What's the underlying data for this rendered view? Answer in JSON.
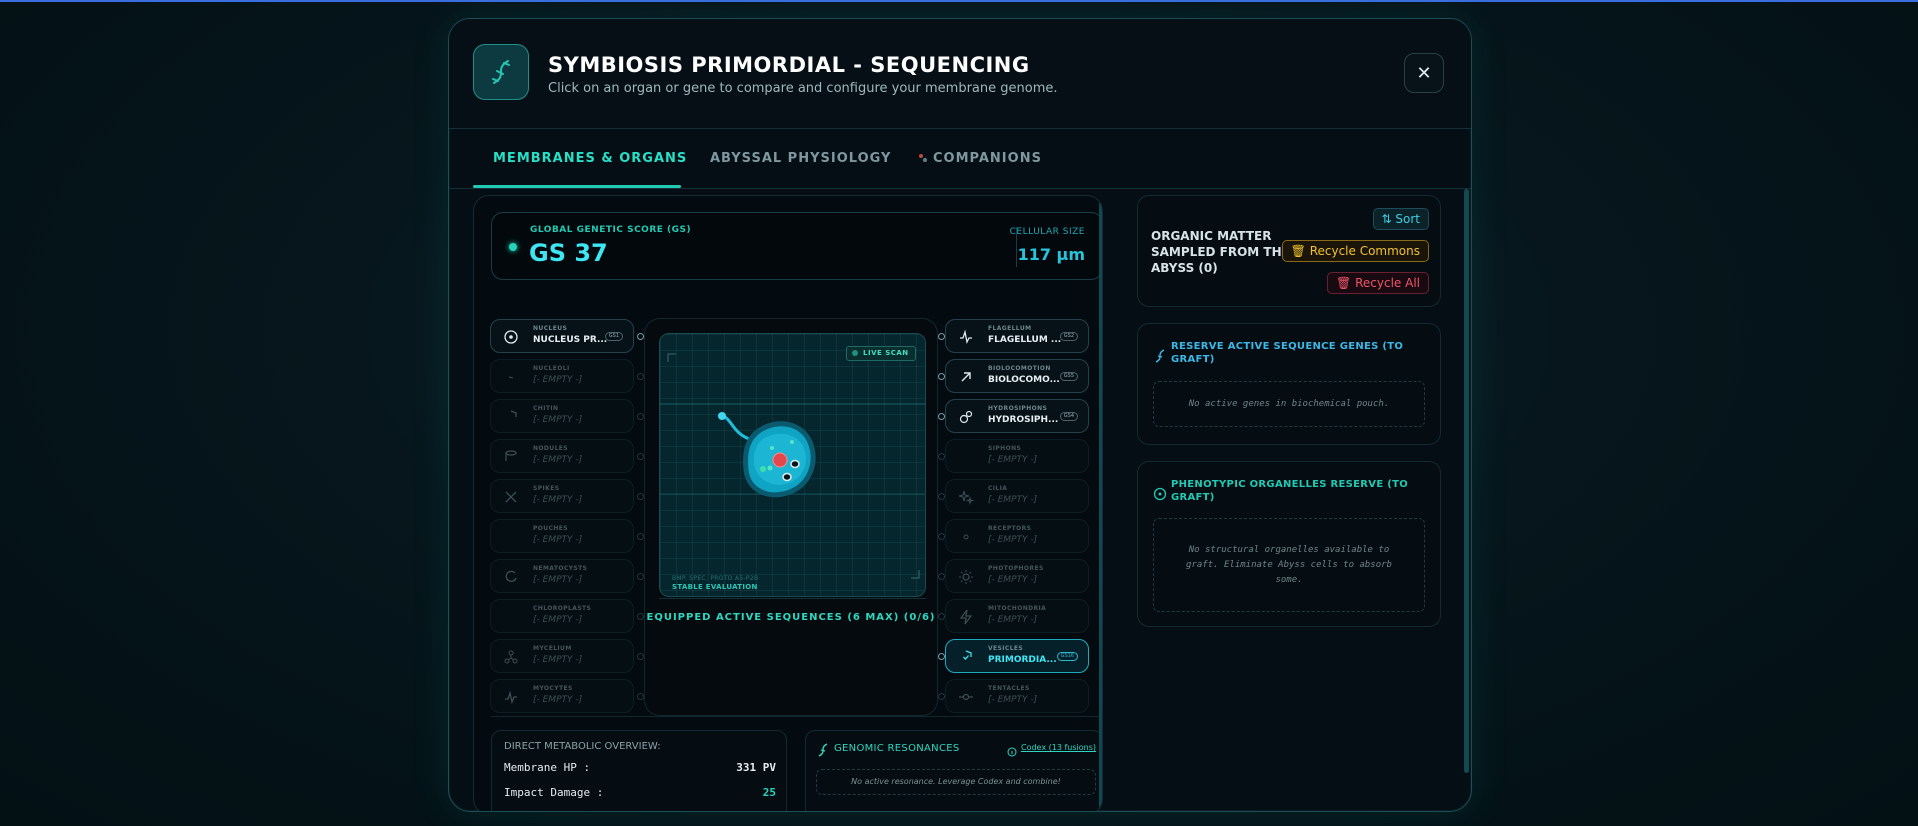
{
  "header": {
    "title": "SYMBIOSIS PRIMORDIAL - SEQUENCING",
    "subtitle": "Click on an organ or gene to compare and configure your membrane genome.",
    "close_label": "✕"
  },
  "tabs": [
    {
      "label": "MEMBRANES & ORGANS",
      "active": true
    },
    {
      "label": "ABYSSAL PHYSIOLOGY",
      "active": false
    },
    {
      "label": "COMPANIONS",
      "active": false
    }
  ],
  "score": {
    "label": "GLOBAL GENETIC SCORE (GS)",
    "value": "GS 37",
    "size_label": "CELLULAR SIZE",
    "size_value": "117 µm"
  },
  "left_slots": [
    {
      "category": "NUCLEUS",
      "value": "NUCLEUS PR...",
      "badge": "GS1",
      "state": "filled",
      "icon": "target-icon"
    },
    {
      "category": "NUCLEOLI",
      "value": "[- EMPTY -]",
      "state": "empty",
      "icon": "dna-icon"
    },
    {
      "category": "CHITIN",
      "value": "[- EMPTY -]",
      "state": "empty",
      "icon": "shield-icon"
    },
    {
      "category": "NODULES",
      "value": "[- EMPTY -]",
      "state": "empty",
      "icon": "database-icon"
    },
    {
      "category": "SPIKES",
      "value": "[- EMPTY -]",
      "state": "empty",
      "icon": "crossed-swords-icon"
    },
    {
      "category": "POUCHES",
      "value": "[- EMPTY -]",
      "state": "empty",
      "icon": "droplet-icon"
    },
    {
      "category": "NEMATOCYSTS",
      "value": "[- EMPTY -]",
      "state": "empty",
      "icon": "swirl-icon"
    },
    {
      "category": "CHLOROPLASTS",
      "value": "[- EMPTY -]",
      "state": "empty",
      "icon": "leaf-icon"
    },
    {
      "category": "MYCELIUM",
      "value": "[- EMPTY -]",
      "state": "empty",
      "icon": "network-icon"
    },
    {
      "category": "MYOCYTES",
      "value": "[- EMPTY -]",
      "state": "empty",
      "icon": "pulse-icon"
    }
  ],
  "right_slots": [
    {
      "category": "FLAGELLUM",
      "value": "FLAGELLUM ...",
      "badge": "GS2",
      "state": "filled",
      "icon": "activity-icon"
    },
    {
      "category": "BIOLOCOMOTION",
      "value": "BIOLOCOMO...",
      "badge": "GS5",
      "state": "filled",
      "icon": "arrow-up-right-icon"
    },
    {
      "category": "HYDROSIPHONS",
      "value": "HYDROSIPH...",
      "badge": "GS4",
      "state": "filled",
      "icon": "bubbles-icon"
    },
    {
      "category": "SIPHONS",
      "value": "[- EMPTY -]",
      "state": "empty",
      "icon": "siphon-icon"
    },
    {
      "category": "CILIA",
      "value": "[- EMPTY -]",
      "state": "empty",
      "icon": "sparkles-icon"
    },
    {
      "category": "RECEPTORS",
      "value": "[- EMPTY -]",
      "state": "empty",
      "icon": "eye-icon"
    },
    {
      "category": "PHOTOPHORES",
      "value": "[- EMPTY -]",
      "state": "empty",
      "icon": "sun-icon"
    },
    {
      "category": "MITOCHONDRIA",
      "value": "[- EMPTY -]",
      "state": "empty",
      "icon": "lightning-icon"
    },
    {
      "category": "VESICLES",
      "value": "PRIMORDIA...",
      "badge": "GS16",
      "state": "active",
      "icon": "shield-check-icon"
    },
    {
      "category": "TENTACLES",
      "value": "[- EMPTY -]",
      "state": "empty",
      "icon": "commit-icon"
    }
  ],
  "scan": {
    "badge": "LIVE SCAN",
    "sub": "BMP. SPEC. PROTO A5-P2B",
    "status": "STABLE EVALUATION",
    "equipped_label": "EQUIPPED ACTIVE SEQUENCES (6 MAX) (0/6)"
  },
  "stats": {
    "title": "DIRECT METABOLIC OVERVIEW:",
    "rows": [
      {
        "label": "Membrane HP :",
        "value": "331 PV"
      },
      {
        "label": "Impact Damage :",
        "value": "25"
      }
    ]
  },
  "resonances": {
    "title": "GENOMIC RESONANCES",
    "codex": "Codex (13 fusions)",
    "empty": "No active resonance. Leverage Codex and combine!"
  },
  "organic": {
    "title": "ORGANIC MATTER SAMPLED FROM THE ABYSS (0)",
    "sort_label": "Sort",
    "recycle_commons_label": "Recycle Commons",
    "recycle_all_label": "Recycle All"
  },
  "reserves": [
    {
      "title": "RESERVE ACTIVE SEQUENCE GENES (TO GRAFT)",
      "empty": "No active genes in biochemical pouch.",
      "color": "#3cb8e6"
    },
    {
      "title": "PHENOTYPIC ORGANELLES RESERVE (TO GRAFT)",
      "empty": "No structural organelles available to graft. Eliminate Abyss cells to absorb some.",
      "color": "#22c9b3"
    }
  ],
  "colors": {
    "accent": "#22c9b3",
    "cyan": "#3ee6f4",
    "gold": "#f2c230",
    "danger": "#f0546c"
  }
}
